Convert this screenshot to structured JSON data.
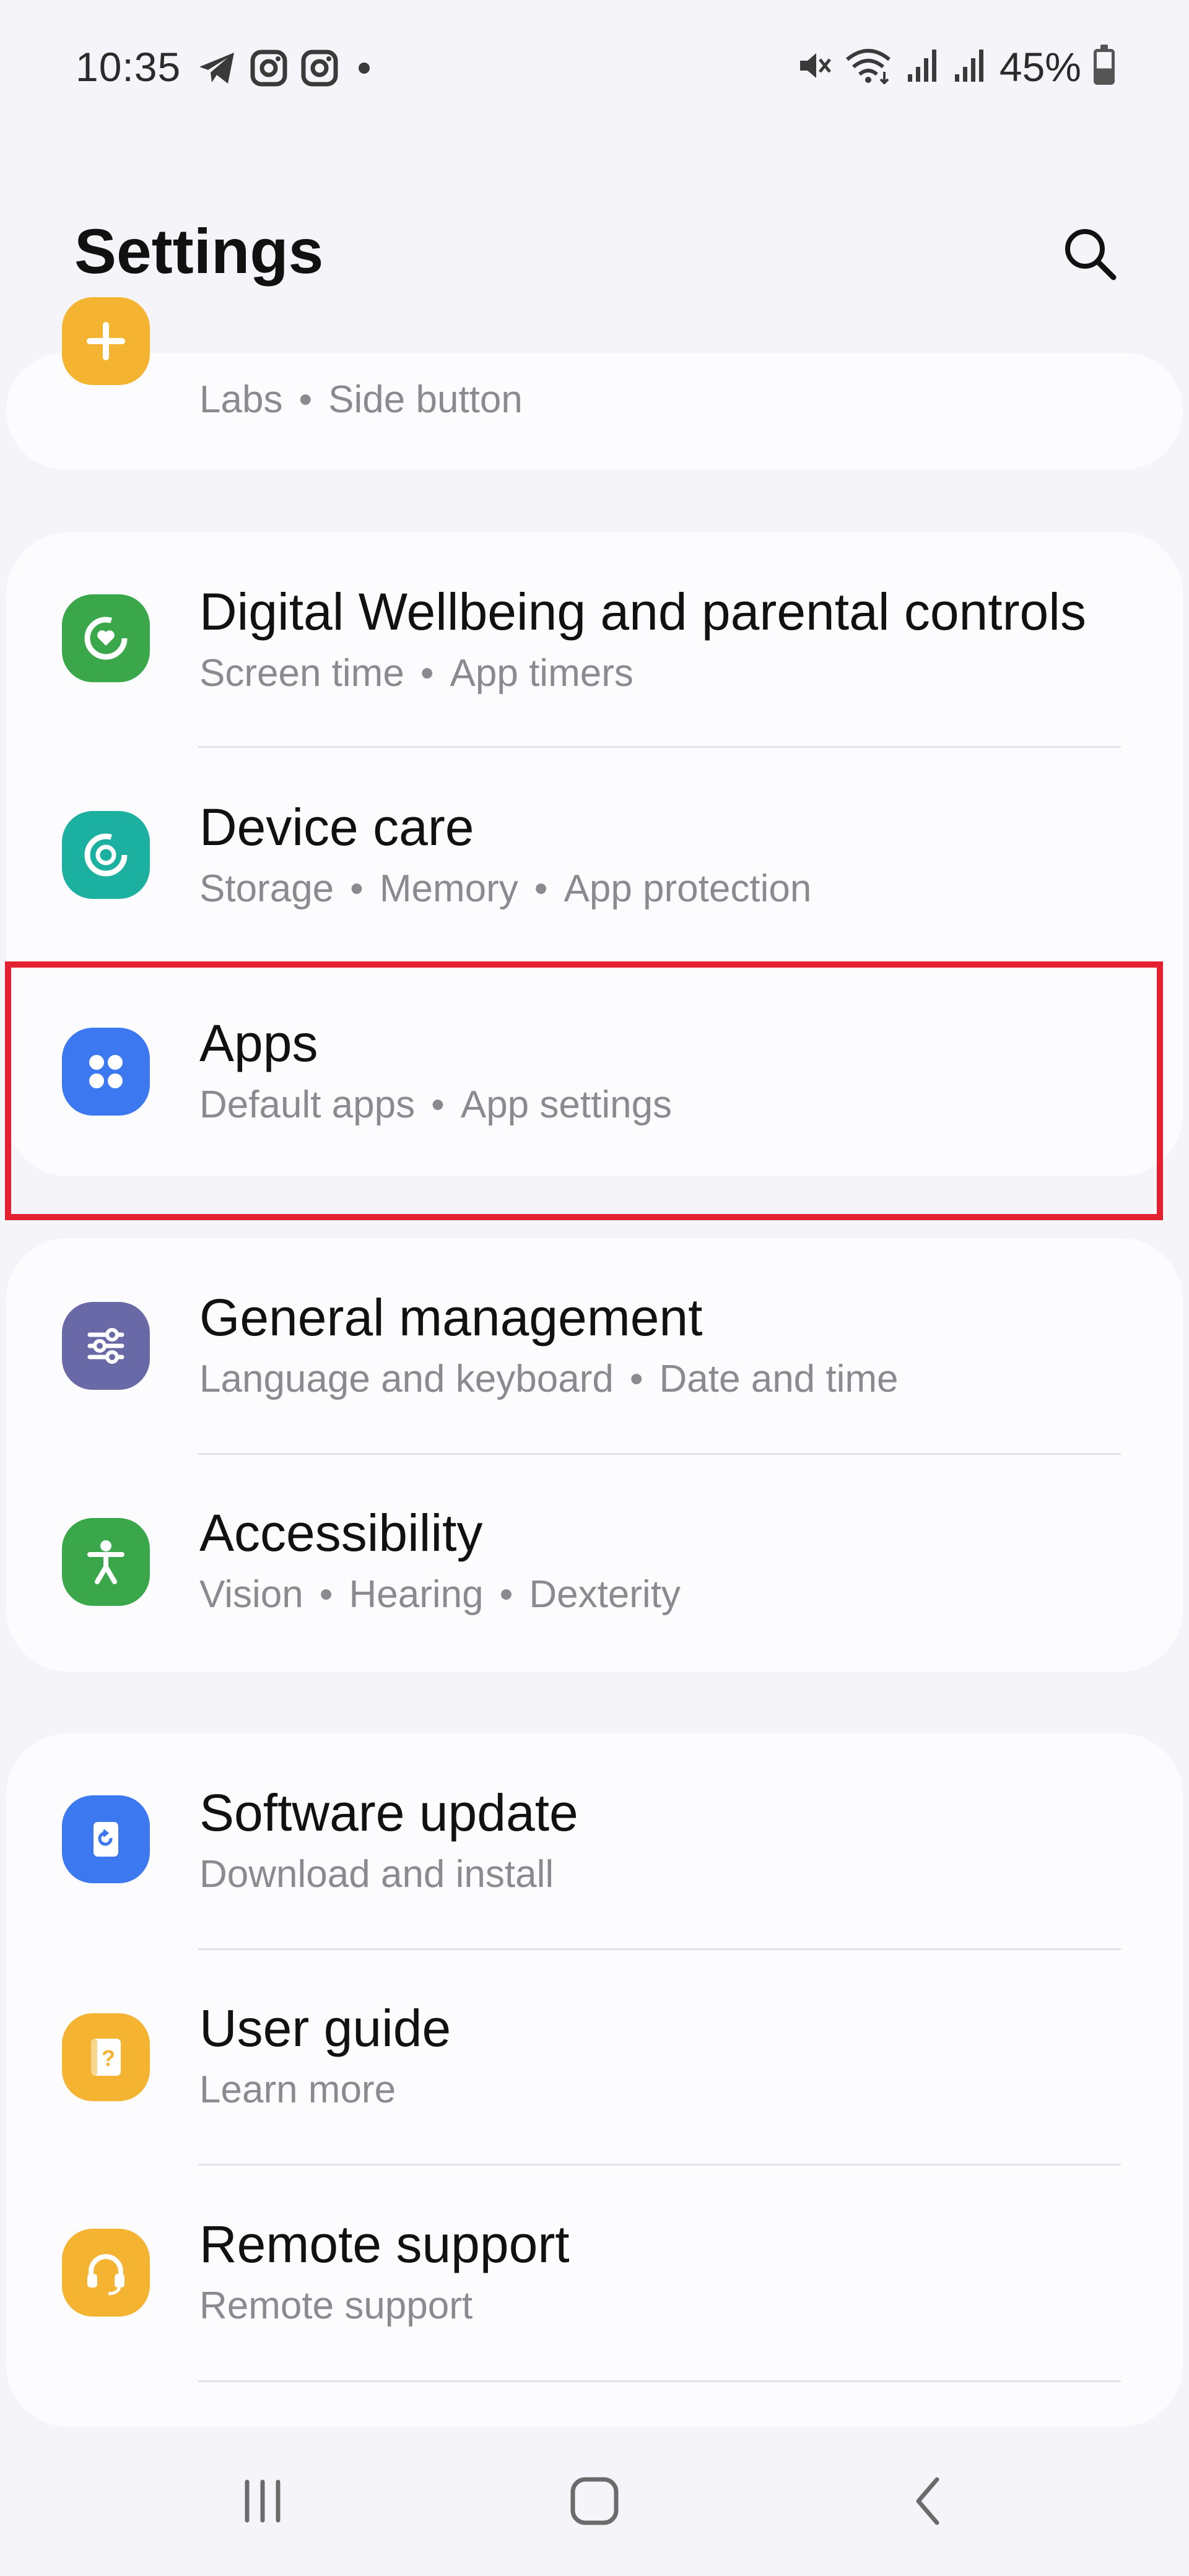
{
  "status_bar": {
    "time": "10:35",
    "left_icons": [
      "telegram-icon",
      "instagram-icon",
      "instagram-icon",
      "notification-dot-icon"
    ],
    "right_icons": [
      "mute-icon",
      "wifi-icon",
      "signal-icon",
      "signal-icon"
    ],
    "battery": "45%",
    "battery_level": 0.45
  },
  "header": {
    "title": "Settings",
    "search_icon": "search-icon"
  },
  "colors": {
    "yellow": "#f4b431",
    "green": "#3aa84a",
    "teal": "#1cb0a0",
    "blue": "#3c78f0",
    "purple": "#6a69a7",
    "highlight": "#e4222f"
  },
  "groups": [
    {
      "items": [
        {
          "icon": "advanced-features-icon",
          "title": "",
          "subtitle_parts": [
            "Labs",
            "Side button"
          ]
        }
      ]
    },
    {
      "items": [
        {
          "icon": "digital-wellbeing-icon",
          "title": "Digital Wellbeing and parental controls",
          "subtitle_parts": [
            "Screen time",
            "App timers"
          ]
        },
        {
          "icon": "device-care-icon",
          "title": "Device care",
          "subtitle_parts": [
            "Storage",
            "Memory",
            "App protection"
          ]
        },
        {
          "icon": "apps-icon",
          "title": "Apps",
          "subtitle_parts": [
            "Default apps",
            "App settings"
          ]
        }
      ]
    },
    {
      "items": [
        {
          "icon": "general-management-icon",
          "title": "General management",
          "subtitle_parts": [
            "Language and keyboard",
            "Date and time"
          ]
        },
        {
          "icon": "accessibility-icon",
          "title": "Accessibility",
          "subtitle_parts": [
            "Vision",
            "Hearing",
            "Dexterity"
          ]
        }
      ]
    },
    {
      "items": [
        {
          "icon": "software-update-icon",
          "title": "Software update",
          "subtitle_parts": [
            "Download and install"
          ]
        },
        {
          "icon": "user-guide-icon",
          "title": "User guide",
          "subtitle_parts": [
            "Learn more"
          ]
        },
        {
          "icon": "remote-support-icon",
          "title": "Remote support",
          "subtitle_parts": [
            "Remote support"
          ]
        }
      ]
    }
  ],
  "nav_bar": {
    "items": [
      "recents-icon",
      "home-icon",
      "back-icon"
    ]
  }
}
